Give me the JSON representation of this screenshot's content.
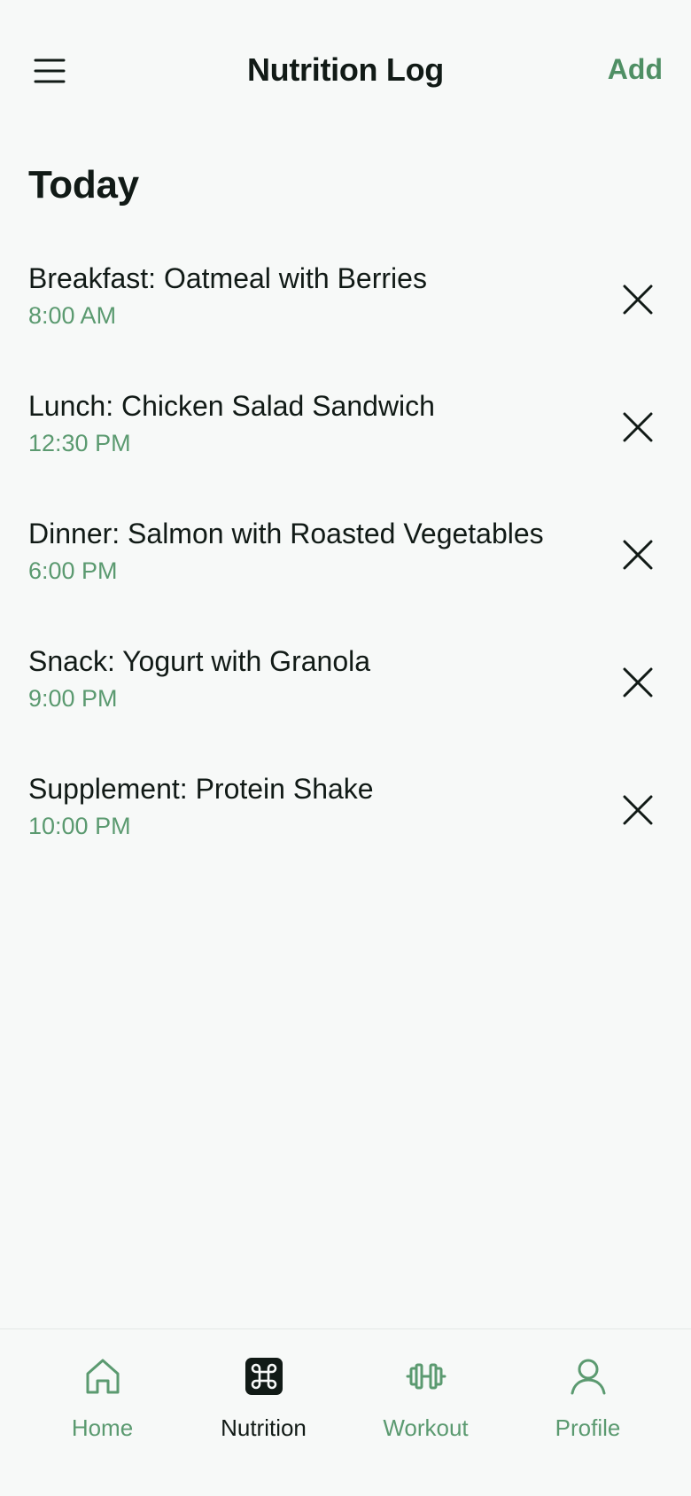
{
  "header": {
    "menu_icon": "hamburger-menu-icon",
    "title": "Nutrition Log",
    "add_label": "Add"
  },
  "section": {
    "title": "Today"
  },
  "entries": [
    {
      "title": "Breakfast: Oatmeal with Berries",
      "time": "8:00 AM"
    },
    {
      "title": "Lunch: Chicken Salad Sandwich",
      "time": "12:30 PM"
    },
    {
      "title": "Dinner: Salmon with Roasted Vegetables",
      "time": "6:00 PM"
    },
    {
      "title": "Snack: Yogurt with Granola",
      "time": "9:00 PM"
    },
    {
      "title": "Supplement: Protein Shake",
      "time": "10:00 PM"
    }
  ],
  "tabs": [
    {
      "label": "Home",
      "icon": "home-icon",
      "active": false
    },
    {
      "label": "Nutrition",
      "icon": "command-icon",
      "active": true
    },
    {
      "label": "Workout",
      "icon": "dumbbell-icon",
      "active": false
    },
    {
      "label": "Profile",
      "icon": "user-icon",
      "active": false
    }
  ],
  "colors": {
    "background": "#f7f9f8",
    "accent": "#4f8f64",
    "text": "#111a16",
    "muted_green": "#5b9a70"
  }
}
